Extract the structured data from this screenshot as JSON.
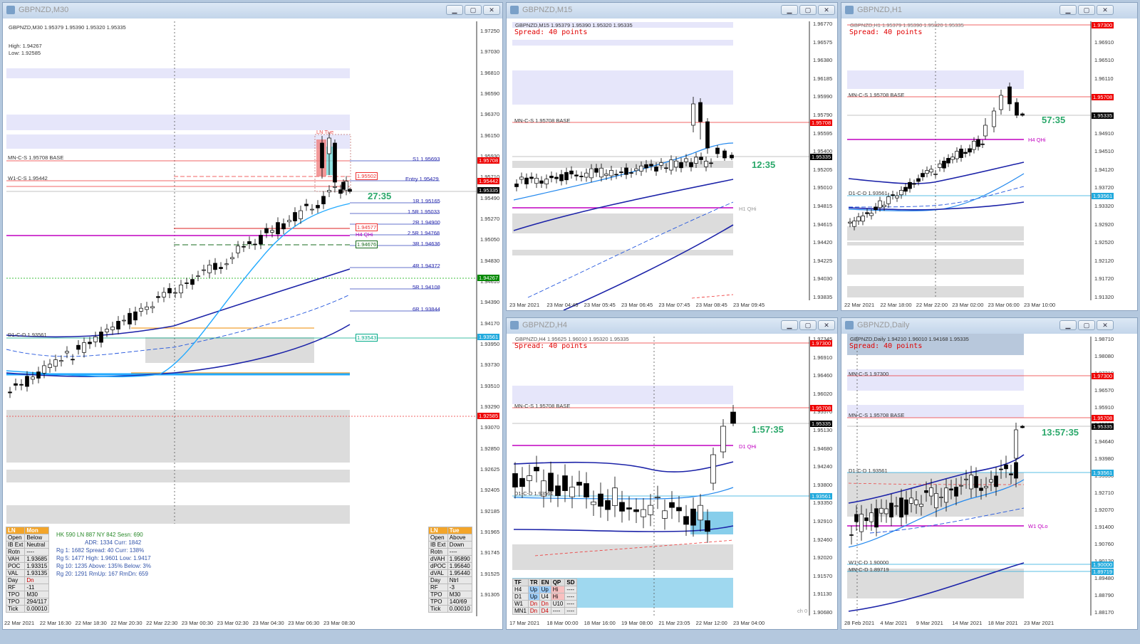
{
  "windows": {
    "m30": {
      "title": "GBPNZD,M30",
      "header": "GBPNZD,M30  1.95379 1.95390 1.95320 1.95335",
      "high": "High: 1.94267",
      "low": "Low: 1.92585",
      "timer": "27:35",
      "price_axis": [
        "1.97250",
        "1.97030",
        "1.96810",
        "1.96590",
        "1.96370",
        "1.96150",
        "1.95930",
        "1.95710",
        "1.95490",
        "1.95270",
        "1.95050",
        "1.94830",
        "1.94610",
        "1.94390",
        "1.94170",
        "1.93950",
        "1.93730",
        "1.93510",
        "1.93290",
        "1.93070",
        "1.92850",
        "1.92625",
        "1.92405",
        "1.92185",
        "1.91965",
        "1.91745",
        "1.91525",
        "1.91305"
      ],
      "tags": {
        "red": "1.95708",
        "red2": "1.95442",
        "black": "1.95335",
        "green": "1.94267",
        "red3": "1.92585",
        "cyan": "1.93561"
      },
      "lines": {
        "mn": "MN-C-S 1.95708 BASE",
        "w1": "W1-C-S 1.95442",
        "d1": "D1-C-D 1.93561",
        "ln_tue": "LN Tue",
        "s1": "S1 1.95693",
        "entry": "Entry 1.95429",
        "r1": "1R 1.95165",
        "r15": "1.5R 1.95033",
        "r2": "2R 1.94900",
        "r25": "2.5R 1.94768",
        "r3": "3R 1.94636",
        "r4": "4R 1.94372",
        "r5": "5R 1.94108",
        "r6": "6R 1.93844",
        "box1": "1.95502",
        "box2": "1.94577",
        "box3": "1.94676",
        "box4": "1.93543",
        "h4qhi": "H4 QHi"
      },
      "time_axis": [
        "22 Mar 2021",
        "22 Mar 16:30",
        "22 Mar 18:30",
        "22 Mar 20:30",
        "22 Mar 22:30",
        "23 Mar 00:30",
        "23 Mar 02:30",
        "23 Mar 04:30",
        "23 Mar 06:30",
        "23 Mar 08:30"
      ],
      "left_table": {
        "header": [
          "LN",
          "Mon"
        ],
        "rows": [
          [
            "Open",
            "Below"
          ],
          [
            "IB Ext",
            "Neutral"
          ],
          [
            "Rotn",
            "----"
          ],
          [
            "VAH",
            "1.93685"
          ],
          [
            "POC",
            "1.93315"
          ],
          [
            "VAL",
            "1.93135"
          ],
          [
            "Day",
            "Dn"
          ],
          [
            "RF",
            "-11"
          ],
          [
            "TPO",
            "M30"
          ],
          [
            "TPO",
            "294/117"
          ],
          [
            "Tick",
            "0.00010"
          ]
        ]
      },
      "mid_stats": [
        "HK 590  LN 887  NY 842  Sesn: 690",
        "ADR:  1334   Curr:  1842",
        "Rg 1:  1682  Spread:  40   Curr:  138%",
        "Rg 5:  1477  High:  1.9601  Low:  1.9417",
        "Rg 10: 1235  Above: 135%  Below:  3%",
        "Rg 20: 1291  RmUp:  167   RmDn:  659"
      ],
      "right_table": {
        "header": [
          "LN",
          "Tue"
        ],
        "rows": [
          [
            "Open",
            "Above"
          ],
          [
            "IB Ext",
            "Down"
          ],
          [
            "Rotn",
            "----"
          ],
          [
            "dVAH",
            "1.95890"
          ],
          [
            "dPOC",
            "1.95640"
          ],
          [
            "dVAL",
            "1.95440"
          ],
          [
            "Day",
            "Ntrl"
          ],
          [
            "RF",
            "-3"
          ],
          [
            "TPO",
            "M30"
          ],
          [
            "TPO",
            "140/69"
          ],
          [
            "Tick",
            "0.00010"
          ]
        ]
      }
    },
    "m15": {
      "title": "GBPNZD,M15",
      "header": "GBPNZD,M15  1.95379 1.95390 1.95320 1.95335",
      "spread": "Spread: 40 points",
      "timer": "12:35",
      "mn": "MN-C-S 1.95708 BASE",
      "h1qhi": "H1 QHi",
      "price_axis": [
        "1.96770",
        "1.96575",
        "1.96380",
        "1.96185",
        "1.95990",
        "1.95790",
        "1.95595",
        "1.95400",
        "1.95205",
        "1.95010",
        "1.94815",
        "1.94615",
        "1.94420",
        "1.94225",
        "1.94030",
        "1.93835"
      ],
      "tags": {
        "red": "1.95708",
        "black": "1.95335"
      },
      "time_axis": [
        "23 Mar 2021",
        "23 Mar 04:45",
        "23 Mar 05:45",
        "23 Mar 06:45",
        "23 Mar 07:45",
        "23 Mar 08:45",
        "23 Mar 09:45"
      ]
    },
    "h1": {
      "title": "GBPNZD,H1",
      "header": "GBPNZD,H1  1.95379 1.95390 1.95320 1.95335",
      "spread": "Spread: 40 points",
      "timer": "57:35",
      "mn": "MN-C-S 1.95708 BASE",
      "h4qhi": "H4 QHi",
      "d1": "D1-C-D 1.93561",
      "price_axis": [
        "1.97300",
        "1.96910",
        "1.96510",
        "1.96110",
        "1.95710",
        "1.95310",
        "1.94910",
        "1.94510",
        "1.94120",
        "1.93720",
        "1.93320",
        "1.92920",
        "1.92520",
        "1.92120",
        "1.91720",
        "1.91320"
      ],
      "tags": {
        "red": "1.97300",
        "red2": "1.95708",
        "black": "1.95335",
        "cyan": "1.93561"
      },
      "time_axis": [
        "22 Mar 2021",
        "22 Mar 18:00",
        "22 Mar 22:00",
        "23 Mar 02:00",
        "23 Mar 06:00",
        "23 Mar 10:00"
      ]
    },
    "h4": {
      "title": "GBPNZD,H4",
      "header": "GBPNZD,H4  1.95625 1.96010 1.95320 1.95335",
      "spread": "Spread: 40 points",
      "timer": "1:57:35",
      "mn": "MN-C-S 1.95708 BASE",
      "d1qhi": "D1 QHi",
      "d1": "D1-C-D 1.93561",
      "ch": "ch 0",
      "price_axis": [
        "1.97345",
        "1.96910",
        "1.96460",
        "1.96020",
        "1.95570",
        "1.95130",
        "1.94680",
        "1.94240",
        "1.93800",
        "1.93350",
        "1.92910",
        "1.92460",
        "1.92020",
        "1.91570",
        "1.91130",
        "1.90680"
      ],
      "tags": {
        "red": "1.97300",
        "red2": "1.95708",
        "black": "1.95335",
        "cyan": "1.93561"
      },
      "time_axis": [
        "17 Mar 2021",
        "18 Mar 00:00",
        "18 Mar 16:00",
        "19 Mar 08:00",
        "21 Mar 23:05",
        "22 Mar 12:00",
        "23 Mar 04:00"
      ],
      "table": {
        "header": [
          "TF",
          "TR",
          "EN",
          "QP",
          "SD"
        ],
        "rows": [
          [
            "H4",
            "Up",
            "Up",
            "Hi",
            "----"
          ],
          [
            "D1",
            "Up",
            "U4",
            "Hi",
            "----"
          ],
          [
            "W1",
            "Dn",
            "Dn",
            "U10",
            "----"
          ],
          [
            "MN1",
            "Dn",
            "D4",
            "----",
            "----"
          ]
        ]
      }
    },
    "daily": {
      "title": "GBPNZD,Daily",
      "header": "GBPNZD,Daily  1.94210 1.96010 1.94168 1.95335",
      "spread": "Spread: 40 points",
      "timer": "13:57:35",
      "mn1": "MN-C-S 1.97300",
      "mn2": "MN-C-S 1.95708 BASE",
      "d1": "D1-C-D 1.93561",
      "w1qlo": "W1 QLo",
      "w1": "W1-C-D 1.90000",
      "mnd": "MN-C-D 1.89719",
      "price_axis": [
        "1.98710",
        "1.98080",
        "1.97210",
        "1.96570",
        "1.95910",
        "1.95270",
        "1.94640",
        "1.93980",
        "1.93350",
        "1.92710",
        "1.92070",
        "1.91400",
        "1.90760",
        "1.90120",
        "1.89480",
        "1.88790",
        "1.88170"
      ],
      "tags": {
        "red": "1.97300",
        "red2": "1.95708",
        "black": "1.95335",
        "cyan": "1.93561",
        "blue1": "1.90000",
        "blue2": "1.89719"
      },
      "time_axis": [
        "28 Feb 2021",
        "4 Mar 2021",
        "9 Mar 2021",
        "14 Mar 2021",
        "18 Mar 2021",
        "23 Mar 2021"
      ]
    }
  },
  "colors": {
    "up_candle": "#ffffff",
    "down_candle": "#000000",
    "zone": "#e6e6fa",
    "grey_zone": "#dcdcdc",
    "timer": "#2aa86a",
    "red_line": "#e33",
    "magenta": "#c000c0",
    "blue": "#0022cc",
    "cyan": "#22aaff"
  }
}
